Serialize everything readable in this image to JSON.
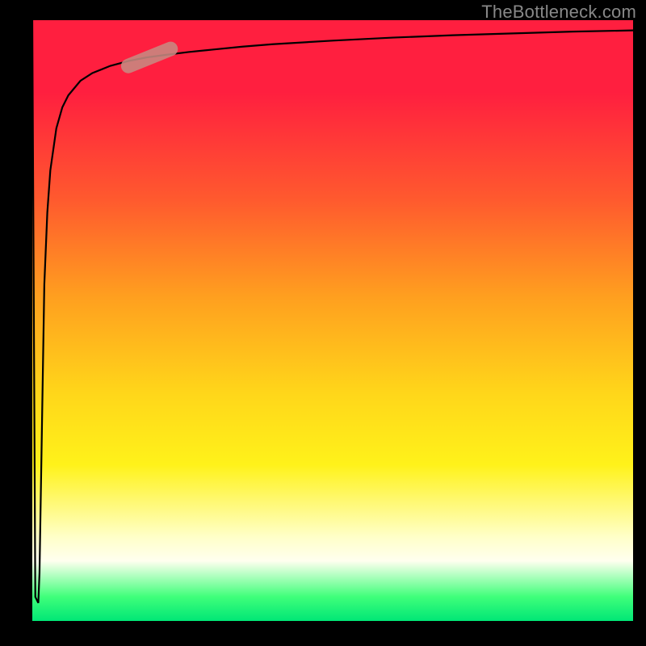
{
  "watermark": "TheBottleneck.com",
  "chart_data": {
    "type": "line",
    "title": "",
    "xlabel": "",
    "ylabel": "",
    "x_range": [
      0,
      1
    ],
    "y_range": [
      0,
      1
    ],
    "series": [
      {
        "name": "curve",
        "x": [
          0.0,
          0.005,
          0.01,
          0.012,
          0.015,
          0.018,
          0.02,
          0.025,
          0.03,
          0.04,
          0.05,
          0.06,
          0.08,
          0.1,
          0.13,
          0.16,
          0.19,
          0.22,
          0.26,
          0.3,
          0.35,
          0.4,
          0.5,
          0.6,
          0.7,
          0.8,
          0.9,
          1.0
        ],
        "y": [
          1.0,
          0.04,
          0.03,
          0.08,
          0.26,
          0.44,
          0.56,
          0.68,
          0.75,
          0.82,
          0.855,
          0.875,
          0.899,
          0.912,
          0.924,
          0.932,
          0.938,
          0.942,
          0.947,
          0.951,
          0.956,
          0.96,
          0.966,
          0.971,
          0.975,
          0.978,
          0.981,
          0.983
        ]
      }
    ],
    "highlight": {
      "x_center": 0.195,
      "y_center": 0.938,
      "angle_deg": -22,
      "length": 0.1,
      "color": "#c78a82"
    },
    "background_gradient": {
      "stops": [
        {
          "offset": 0.0,
          "color": "#ff1f3f"
        },
        {
          "offset": 0.12,
          "color": "#ff1f3f"
        },
        {
          "offset": 0.3,
          "color": "#ff5a2e"
        },
        {
          "offset": 0.46,
          "color": "#ff9f1f"
        },
        {
          "offset": 0.62,
          "color": "#ffd61a"
        },
        {
          "offset": 0.74,
          "color": "#fff21a"
        },
        {
          "offset": 0.86,
          "color": "#ffffc8"
        },
        {
          "offset": 0.9,
          "color": "#ffffef"
        },
        {
          "offset": 0.96,
          "color": "#3fff7a"
        },
        {
          "offset": 1.0,
          "color": "#00e676"
        }
      ]
    }
  }
}
